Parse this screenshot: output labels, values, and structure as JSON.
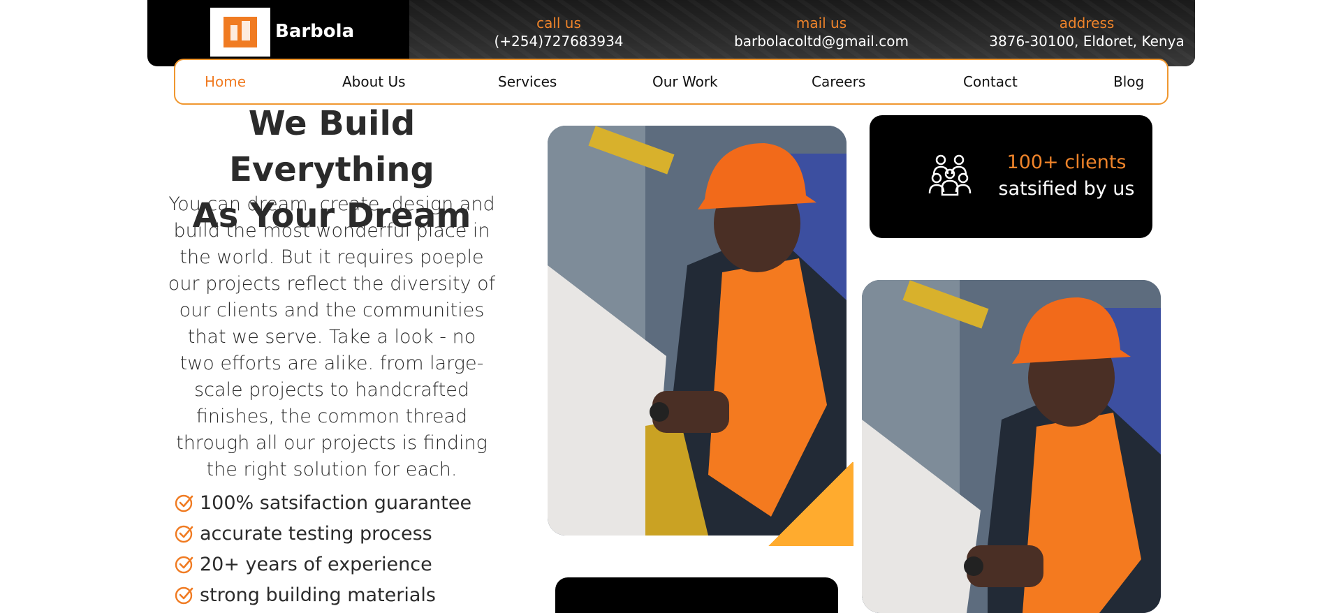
{
  "brand": {
    "name": "Barbola"
  },
  "contact": {
    "call_label": "call us",
    "call_value": "(+254)727683934",
    "mail_label": "mail us",
    "mail_value": "barbolacoltd@gmail.com",
    "address_label": "address",
    "address_value": "3876-30100, Eldoret, Kenya"
  },
  "nav": {
    "items": [
      {
        "label": "Home",
        "active": true
      },
      {
        "label": "About Us"
      },
      {
        "label": "Services"
      },
      {
        "label": "Our Work"
      },
      {
        "label": "Careers"
      },
      {
        "label": "Contact"
      },
      {
        "label": "Blog"
      }
    ]
  },
  "hero": {
    "title_line1": "We Build Everything",
    "title_line2": "As Your Dream",
    "description": "You can dream, create, design and build the most wonderful place in the world. But it requires poeple our projects reflect the diversity of our clients and the communities that we serve. Take a look - no two efforts are alike. from large-scale projects to handcrafted finishes, the common thread through all our projects is finding the right solution for each.",
    "features": [
      "100% satsifaction guarantee",
      "accurate testing process",
      "20+ years of experience",
      "strong building materials"
    ]
  },
  "stats": {
    "clients": "100+ clients",
    "clients_sub": "satsified by us"
  },
  "icons": {
    "logo": "building-logo-icon",
    "check": "check-circle-icon",
    "people": "people-group-icon"
  },
  "colors": {
    "accent": "#f07b22",
    "dark": "#000000",
    "text": "#2b2b2b"
  }
}
